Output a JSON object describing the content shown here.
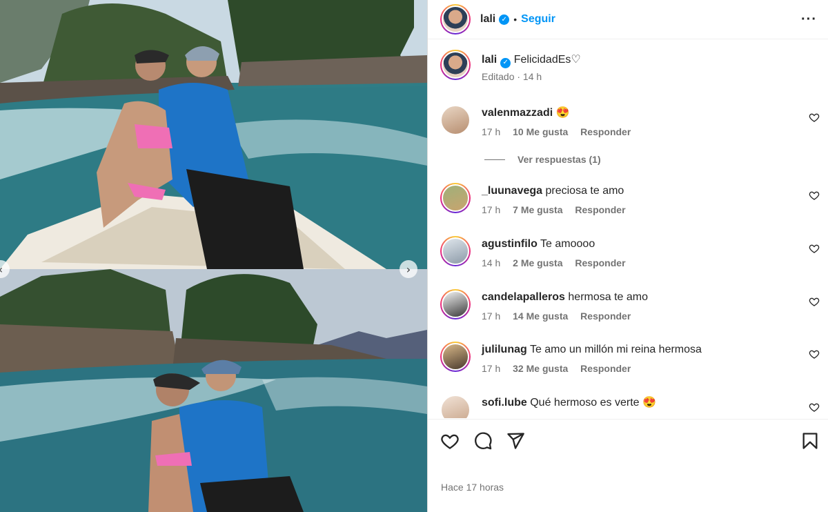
{
  "post": {
    "author": "lali",
    "follow_label": "Seguir",
    "separator": "•",
    "caption": "FelicidadEs♡",
    "caption_meta": "Editado · 14 h",
    "view_replies_label": "Ver respuestas (1)",
    "timestamp": "Hace 17 horas"
  },
  "comments": [
    {
      "user": "valenmazzadi",
      "text": "😍",
      "time": "17 h",
      "likes": "10 Me gusta",
      "reply": "Responder"
    },
    {
      "user": "_luunavega",
      "text": "preciosa te amo",
      "time": "17 h",
      "likes": "7 Me gusta",
      "reply": "Responder"
    },
    {
      "user": "agustinfilo",
      "text": "Te amoooo",
      "time": "14 h",
      "likes": "2 Me gusta",
      "reply": "Responder"
    },
    {
      "user": "candelapalleros",
      "text": "hermosa te amo",
      "time": "17 h",
      "likes": "14 Me gusta",
      "reply": "Responder"
    },
    {
      "user": "julilunag",
      "text": "Te amo un millón mi reina hermosa",
      "time": "17 h",
      "likes": "32 Me gusta",
      "reply": "Responder"
    },
    {
      "user": "sofi.lube",
      "text": "Qué hermoso es verte 😍",
      "time": "",
      "likes": "",
      "reply": ""
    }
  ],
  "icons": {
    "verified": "verified-badge-icon",
    "more": "more-options-icon",
    "like": "heart-icon",
    "comment": "comment-icon",
    "share": "share-icon",
    "save": "bookmark-icon"
  },
  "colors": {
    "accent": "#0095f6",
    "muted": "#737373",
    "text": "#262626"
  }
}
